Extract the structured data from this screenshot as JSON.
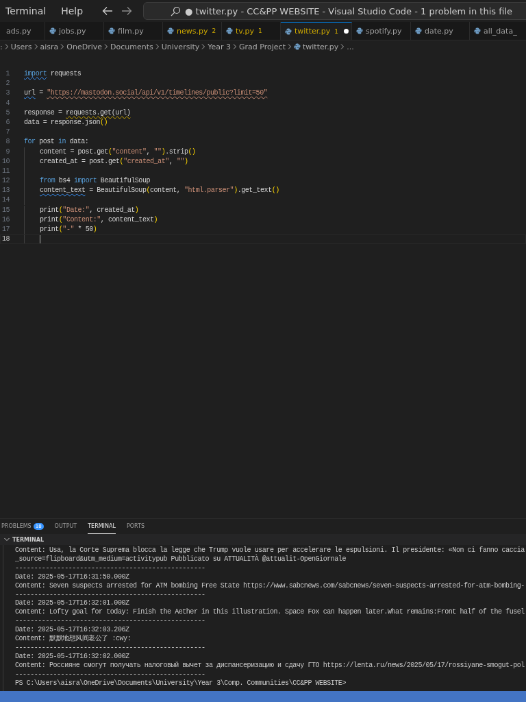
{
  "menu": [
    "Terminal",
    "Help"
  ],
  "title_search": {
    "text": "● twitter.py - CC&PP WEBSITE - Visual Studio Code - 1 problem in this file"
  },
  "tabs": [
    {
      "label": "ads.py",
      "warning": false,
      "selected": false,
      "modified": false
    },
    {
      "label": "jobs.py",
      "warning": false,
      "selected": false,
      "modified": false
    },
    {
      "label": "film.py",
      "warning": false,
      "selected": false,
      "modified": false
    },
    {
      "label": "news.py",
      "badge": "2",
      "warning": true,
      "selected": false,
      "modified": false
    },
    {
      "label": "tv.py",
      "badge": "1",
      "warning": true,
      "selected": false,
      "modified": false
    },
    {
      "label": "twitter.py",
      "badge": "1",
      "warning": true,
      "selected": true,
      "modified": true
    },
    {
      "label": "spotify.py",
      "warning": false,
      "selected": false,
      "modified": false
    },
    {
      "label": "date.py",
      "warning": false,
      "selected": false,
      "modified": false
    },
    {
      "label": "all_data_",
      "warning": false,
      "selected": false,
      "modified": false
    }
  ],
  "breadcrumb": [
    ":",
    "Users",
    "aisra",
    "OneDrive",
    "Documents",
    "University",
    "Year 3",
    "Grad Project",
    "twitter.py",
    "..."
  ],
  "editor": {
    "lines": [
      {
        "number": "1",
        "tokens": [
          {
            "text": "import",
            "kind": "keyword",
            "info_squiggle": true
          },
          {
            "text": " requests",
            "kind": "plain"
          }
        ]
      },
      {
        "number": "2"
      },
      {
        "number": "3",
        "tokens": [
          {
            "text": "url",
            "kind": "plain",
            "info_squiggle": true
          },
          {
            "text": " = ",
            "kind": "plain"
          },
          {
            "text": "\"https://mastodon.social/api/v1/timelines/public?limit=50\"",
            "kind": "string",
            "link_underline": true
          }
        ]
      },
      {
        "number": "4"
      },
      {
        "number": "5",
        "tokens": [
          {
            "text": "response = ",
            "kind": "plain"
          },
          {
            "text": "requests.get(url)",
            "kind": "plain",
            "warning_squiggle": true
          }
        ]
      },
      {
        "number": "6",
        "tokens": [
          {
            "text": "data = response.json",
            "kind": "plain"
          },
          {
            "text": "()",
            "kind": "paren"
          }
        ]
      },
      {
        "number": "7"
      },
      {
        "number": "8",
        "tokens": [
          {
            "text": "for",
            "kind": "control"
          },
          {
            "text": " post ",
            "kind": "plain"
          },
          {
            "text": "in",
            "kind": "control"
          },
          {
            "text": " data:",
            "kind": "plain"
          }
        ],
        "children": [
          {
            "number": "9",
            "tokens": [
              {
                "text": "content = post.get",
                "kind": "plain"
              },
              {
                "text": "(",
                "kind": "paren"
              },
              {
                "text": "\"content\"",
                "kind": "string"
              },
              {
                "text": ", ",
                "kind": "plain"
              },
              {
                "text": "\"\"",
                "kind": "string"
              },
              {
                "text": ")",
                "kind": "paren"
              },
              {
                "text": ".strip",
                "kind": "plain"
              },
              {
                "text": "()",
                "kind": "paren"
              }
            ]
          },
          {
            "number": "10",
            "tokens": [
              {
                "text": "created_at = post.get",
                "kind": "plain"
              },
              {
                "text": "(",
                "kind": "paren"
              },
              {
                "text": "\"created_at\"",
                "kind": "string"
              },
              {
                "text": ", ",
                "kind": "plain"
              },
              {
                "text": "\"\"",
                "kind": "string"
              },
              {
                "text": ")",
                "kind": "paren"
              }
            ]
          },
          {
            "number": "11"
          },
          {
            "number": "12",
            "tokens": [
              {
                "text": "from",
                "kind": "control"
              },
              {
                "text": " bs4 ",
                "kind": "plain"
              },
              {
                "text": "import",
                "kind": "keyword"
              },
              {
                "text": " BeautifulSoup",
                "kind": "plain"
              }
            ]
          },
          {
            "number": "13",
            "tokens": [
              {
                "text": "content_text",
                "kind": "plain",
                "info_squiggle": true
              },
              {
                "text": " = BeautifulSoup",
                "kind": "plain"
              },
              {
                "text": "(",
                "kind": "paren"
              },
              {
                "text": "content, ",
                "kind": "plain"
              },
              {
                "text": "\"html.parser\"",
                "kind": "string"
              },
              {
                "text": ")",
                "kind": "paren"
              },
              {
                "text": ".get_text",
                "kind": "plain"
              },
              {
                "text": "()",
                "kind": "paren"
              }
            ]
          },
          {
            "number": "14"
          },
          {
            "number": "15",
            "tokens": [
              {
                "text": "print",
                "kind": "plain"
              },
              {
                "text": "(",
                "kind": "paren"
              },
              {
                "text": "\"Date:\"",
                "kind": "string"
              },
              {
                "text": ", created_at",
                "kind": "plain"
              },
              {
                "text": ")",
                "kind": "paren"
              }
            ]
          },
          {
            "number": "16",
            "tokens": [
              {
                "text": "print",
                "kind": "plain"
              },
              {
                "text": "(",
                "kind": "paren"
              },
              {
                "text": "\"Content:\"",
                "kind": "string"
              },
              {
                "text": ", content_text",
                "kind": "plain"
              },
              {
                "text": ")",
                "kind": "paren"
              }
            ]
          },
          {
            "number": "17",
            "tokens": [
              {
                "text": "print",
                "kind": "plain"
              },
              {
                "text": "(",
                "kind": "paren"
              },
              {
                "text": "\"-\"",
                "kind": "string"
              },
              {
                "text": " * 50",
                "kind": "plain"
              },
              {
                "text": ")",
                "kind": "paren"
              }
            ]
          },
          {
            "number": "18",
            "current": true
          }
        ]
      }
    ]
  },
  "panel_tabs": [
    {
      "label": "PROBLEMS",
      "badge": "18",
      "selected": false
    },
    {
      "label": "OUTPUT",
      "selected": false
    },
    {
      "label": "TERMINAL",
      "selected": true
    },
    {
      "label": "PORTS",
      "selected": false
    }
  ],
  "terminal": {
    "header": "TERMINAL",
    "expanded": true,
    "lines": [
      "Content: Usa, la Corte Suprema blocca la legge che Trump vuole usare per accelerare le espulsioni. Il presidente: «Non ci fanno caccia",
      "_source=flipboard&utm_medium=activitypub Pubblicato su ATTUALITÀ @attualit-OpenGiornale",
      "--------------------------------------------------",
      "Date: 2025-05-17T16:31:50.000Z",
      "Content: Seven suspects arrested for ATM bombing Free State https://www.sabcnews.com/sabcnews/seven-suspects-arrested-for-atm-bombing-",
      "--------------------------------------------------",
      "Date: 2025-05-17T16:32:01.000Z",
      "Content: Lofty goal for today: Finish the Aether in this illustration. Space Fox can happen later.What remains:Front half of the fusel",
      "--------------------------------------------------",
      "Date: 2025-05-17T16:32:03.206Z",
      "Content: 默默地想风间老公了 :cwy:",
      "--------------------------------------------------",
      "Date: 2025-05-17T16:32:02.000Z",
      "Content: Россияне смогут получать налоговый вычет за диспансеризацию и сдачу ГТО https://lenta.ru/news/2025/05/17/rossiyane-smogut-pol",
      "--------------------------------------------------",
      "PS C:\\Users\\aisra\\OneDrive\\Documents\\University\\Year 3\\Comp. Communities\\CC&PP WEBSITE>"
    ]
  }
}
